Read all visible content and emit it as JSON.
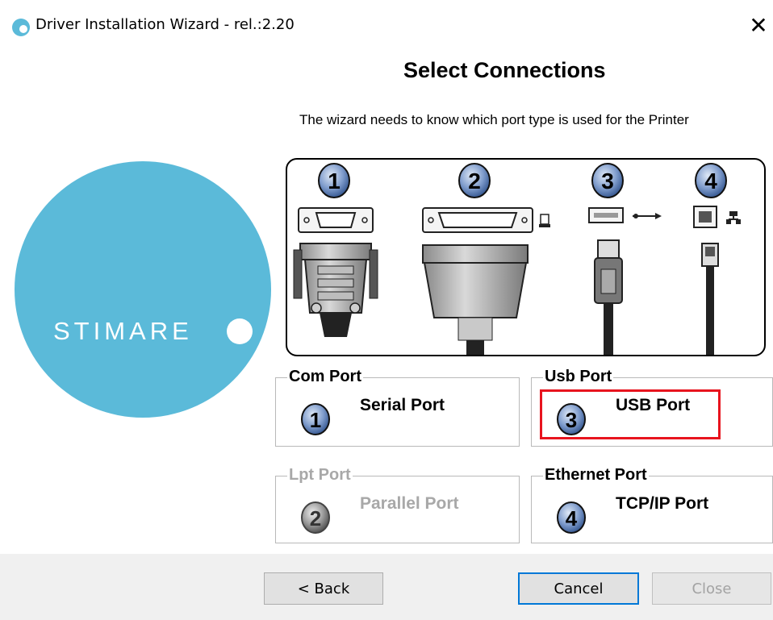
{
  "window": {
    "title": "Driver Installation Wizard - rel.:2.20",
    "close_glyph": "✕",
    "icon": "app-circle-icon"
  },
  "logo": {
    "brand": "STIMARE",
    "color": "#5bbad9"
  },
  "header": {
    "heading": "Select Connections",
    "description": "The wizard needs to know which port type is used for the Printer"
  },
  "ports_diagram": {
    "numbers": [
      "1",
      "2",
      "3",
      "4"
    ],
    "icons": [
      "serial-connector-icon",
      "parallel-connector-icon",
      "usb-connector-icon",
      "ethernet-connector-icon"
    ]
  },
  "groups": {
    "com": {
      "legend": "Com Port",
      "option_number": "1",
      "option_label": "Serial Port",
      "enabled": true
    },
    "usb": {
      "legend": "Usb Port",
      "option_number": "3",
      "option_label": "USB Port",
      "enabled": true,
      "selected": true
    },
    "lpt": {
      "legend": "Lpt Port",
      "option_number": "2",
      "option_label": "Parallel Port",
      "enabled": false
    },
    "ethernet": {
      "legend": "Ethernet Port",
      "option_number": "4",
      "option_label": "TCP/IP Port",
      "enabled": true
    }
  },
  "buttons": {
    "back": "< Back",
    "cancel": "Cancel",
    "close": "Close"
  },
  "colors": {
    "highlight": "#e8141e",
    "accent": "#0078d7",
    "disabled_text": "#a8a8a8"
  }
}
